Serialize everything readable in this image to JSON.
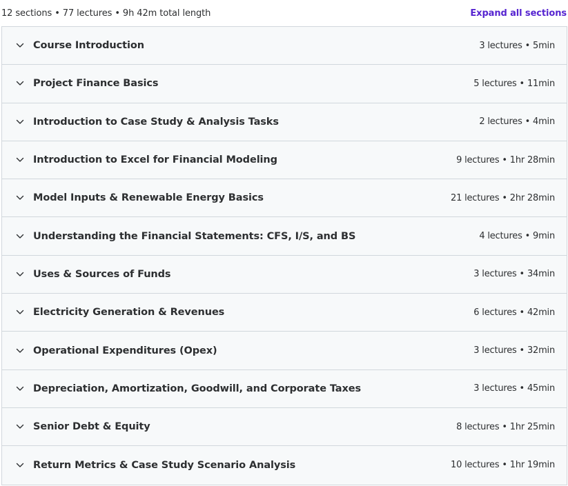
{
  "curriculum": {
    "summary": "12 sections • 77 lectures • 9h 42m total length",
    "expand_label": "Expand all sections",
    "accent_color": "#5624d0",
    "sections": [
      {
        "title": "Course Introduction",
        "meta": "3 lectures • 5min"
      },
      {
        "title": "Project Finance Basics",
        "meta": "5 lectures • 11min"
      },
      {
        "title": "Introduction to Case Study & Analysis Tasks",
        "meta": "2 lectures • 4min"
      },
      {
        "title": "Introduction to Excel for Financial Modeling",
        "meta": "9 lectures • 1hr 28min"
      },
      {
        "title": "Model Inputs & Renewable Energy Basics",
        "meta": "21 lectures • 2hr 28min"
      },
      {
        "title": "Understanding the Financial Statements: CFS, I/S, and BS",
        "meta": "4 lectures • 9min"
      },
      {
        "title": "Uses & Sources of Funds",
        "meta": "3 lectures • 34min"
      },
      {
        "title": "Electricity Generation & Revenues",
        "meta": "6 lectures • 42min"
      },
      {
        "title": "Operational Expenditures (Opex)",
        "meta": "3 lectures • 32min"
      },
      {
        "title": "Depreciation, Amortization, Goodwill, and Corporate Taxes",
        "meta": "3 lectures • 45min"
      },
      {
        "title": "Senior Debt & Equity",
        "meta": "8 lectures • 1hr 25min"
      },
      {
        "title": "Return Metrics & Case Study Scenario Analysis",
        "meta": "10 lectures • 1hr 19min"
      }
    ]
  }
}
